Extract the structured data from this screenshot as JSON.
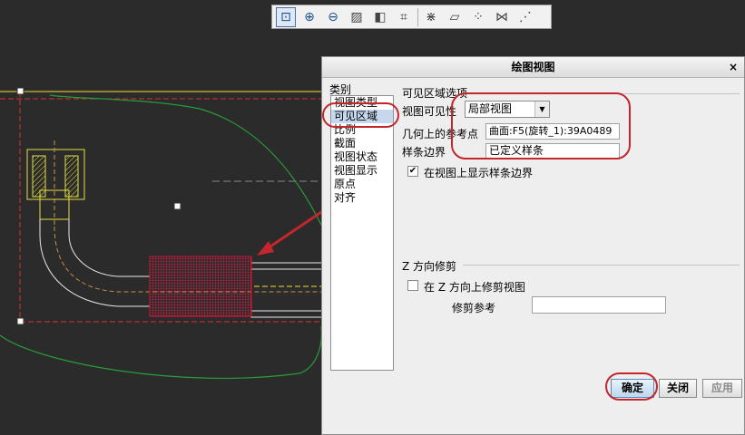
{
  "toolbar": {
    "icons": [
      "zoom-fit-icon",
      "zoom-in-icon",
      "zoom-out-icon",
      "repaint-icon",
      "shading-icon",
      "saved-orientations-icon",
      "datum-axes-icon",
      "datum-planes-icon",
      "datum-points-icon",
      "coordinate-systems-icon",
      "annotations-icon"
    ]
  },
  "dialog": {
    "title": "绘图视图",
    "close": "×",
    "category_label": "类别",
    "categories": [
      "视图类型",
      "可见区域",
      "比例",
      "截面",
      "视图状态",
      "视图显示",
      "原点",
      "对齐"
    ],
    "active_category": "可见区域",
    "visible_area": {
      "section_title": "可见区域选项",
      "visibility_label": "视图可见性",
      "visibility_value": "局部视图",
      "ref_point_label": "几何上的参考点",
      "ref_point_value": "曲面:F5(旋转_1):39A0489",
      "spline_label": "样条边界",
      "spline_value": "已定义样条",
      "show_spline_label": "在视图上显示样条边界",
      "show_spline_checked": true
    },
    "z_clip": {
      "section_title": "Z 方向修剪",
      "clip_label": "在 Z 方向上修剪视图",
      "clip_checked": false,
      "clip_ref_label": "修剪参考",
      "clip_ref_value": ""
    },
    "buttons": {
      "ok": "确定",
      "close": "关闭",
      "apply": "应用"
    }
  },
  "colors": {
    "canvas_bg": "#2b2b2b",
    "annotation_red": "#c3262c",
    "hatch_red": "#d01030",
    "highlight_yellow": "#f0e030",
    "boundary_green": "#2a9a3a"
  }
}
